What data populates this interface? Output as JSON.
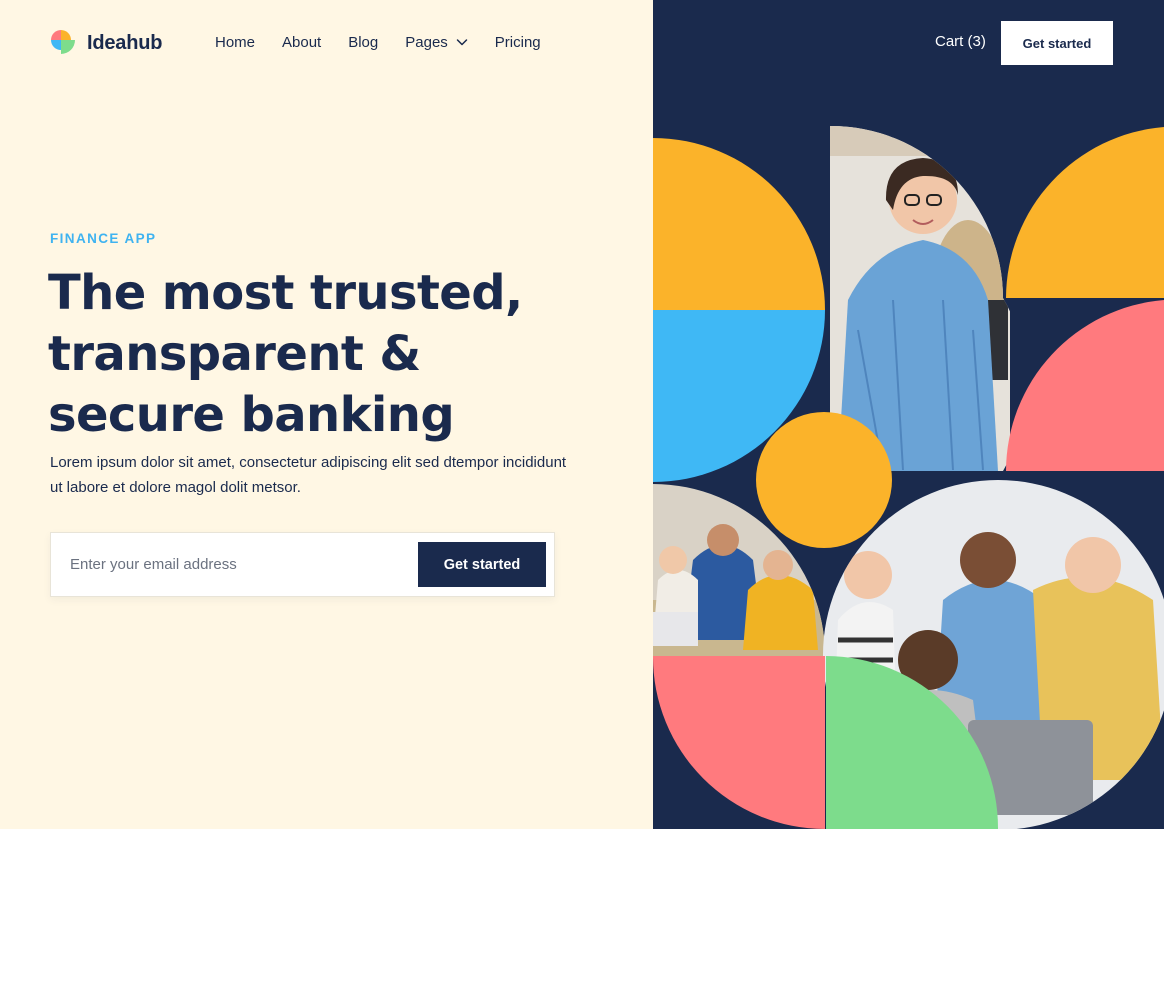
{
  "brand": {
    "name": "Ideahub",
    "logo_icon": "petal-logo-icon",
    "colors": {
      "navy": "#1a2a4d",
      "cream": "#fff7e4",
      "yellow": "#fbb32a",
      "sky": "#3fb8f5",
      "coral": "#ff7a7e",
      "green": "#7ddc8c",
      "eyebrow": "#3fb3f0"
    }
  },
  "nav": {
    "items": [
      {
        "label": "Home"
      },
      {
        "label": "About"
      },
      {
        "label": "Blog"
      },
      {
        "label": "Pages",
        "icon": "chevron-down-icon"
      },
      {
        "label": "Pricing"
      }
    ],
    "cart_label": "Cart (3)",
    "cta_label": "Get started"
  },
  "hero": {
    "eyebrow": "FINANCE APP",
    "headline": "The most trusted, transparent & secure banking",
    "subtext": "Lorem ipsum dolor sit amet, consectetur adipiscing elit sed dtempor incididunt ut labore et dolore magol dolit metsor.",
    "email_placeholder": "Enter your email address",
    "email_value": "",
    "cta_label": "Get started"
  },
  "collage": {
    "photos": [
      {
        "name": "woman-with-glasses-photo",
        "depicts": "smiling woman with glasses in blue shirt"
      },
      {
        "name": "classroom-group-photo",
        "depicts": "people at a table working"
      },
      {
        "name": "team-laptop-photo",
        "depicts": "team gathered around a laptop"
      }
    ]
  }
}
